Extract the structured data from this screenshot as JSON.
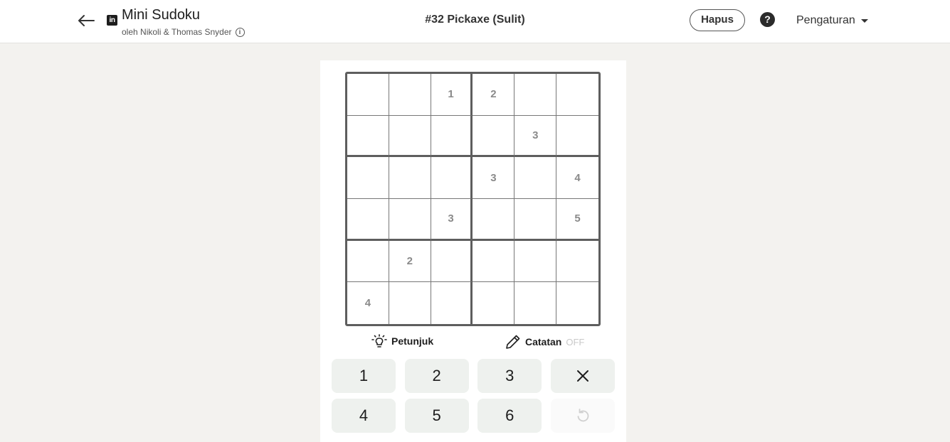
{
  "header": {
    "app_title": "Mini Sudoku",
    "logo_text": "in",
    "byline": "oleh Nikoli & Thomas Snyder",
    "puzzle_title": "#32 Pickaxe (Sulit)",
    "clear_label": "Hapus",
    "help_symbol": "?",
    "settings_label": "Pengaturan"
  },
  "grid": {
    "rows": [
      [
        "",
        "",
        "1",
        "2",
        "",
        ""
      ],
      [
        "",
        "",
        "",
        "",
        "3",
        ""
      ],
      [
        "",
        "",
        "",
        "3",
        "",
        "4"
      ],
      [
        "",
        "",
        "3",
        "",
        "",
        "5"
      ],
      [
        "",
        "2",
        "",
        "",
        "",
        ""
      ],
      [
        "4",
        "",
        "",
        "",
        "",
        ""
      ]
    ]
  },
  "tools": {
    "hint_label": "Petunjuk",
    "notes_label": "Catatan",
    "notes_state": "OFF"
  },
  "numpad": {
    "keys": [
      "1",
      "2",
      "3",
      "4",
      "5",
      "6"
    ]
  },
  "icons": {
    "back": "arrow-left-icon",
    "hint": "lightbulb-icon",
    "notes": "pencil-icon",
    "erase": "close-icon",
    "undo": "undo-icon"
  }
}
